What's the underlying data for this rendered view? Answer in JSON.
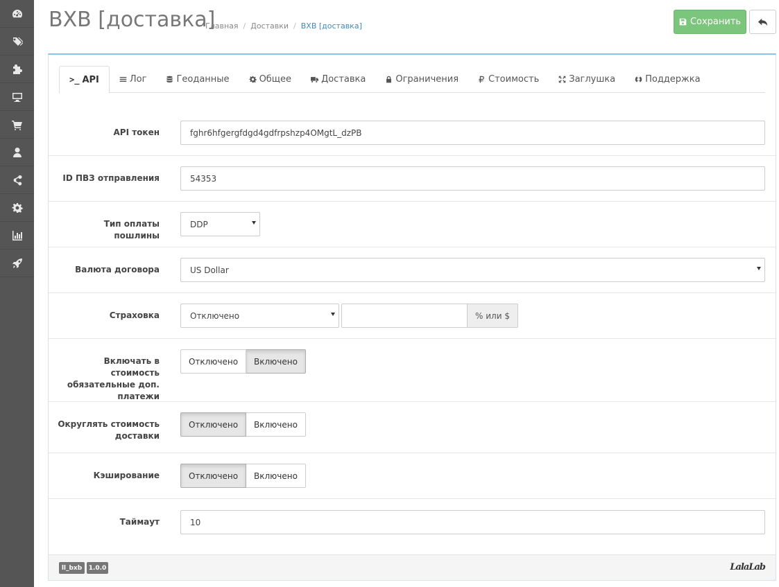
{
  "sidebar": {
    "items": [
      {
        "icon": "dashboard-icon"
      },
      {
        "icon": "tags-icon"
      },
      {
        "icon": "puzzle-icon"
      },
      {
        "icon": "desktop-icon"
      },
      {
        "icon": "cart-icon"
      },
      {
        "icon": "user-icon"
      },
      {
        "icon": "share-icon"
      },
      {
        "icon": "gear-icon"
      },
      {
        "icon": "bar-chart-icon"
      },
      {
        "icon": "rocket-icon"
      }
    ]
  },
  "header": {
    "title": "BXB [доставка]",
    "breadcrumb": [
      "Главная",
      "Доставки",
      "BXB [доставка]"
    ],
    "save_label": "Сохранить"
  },
  "tabs": [
    {
      "label": "API",
      "prefix": ">_",
      "icon": "terminal-icon",
      "active": true
    },
    {
      "label": "Лог",
      "icon": "list-icon"
    },
    {
      "label": "Геоданные",
      "icon": "database-icon"
    },
    {
      "label": "Общее",
      "icon": "gear-icon"
    },
    {
      "label": "Доставка",
      "icon": "truck-icon"
    },
    {
      "label": "Ограничения",
      "icon": "lock-icon"
    },
    {
      "label": "Стоимость",
      "icon": "ruble-icon"
    },
    {
      "label": "Заглушка",
      "icon": "expand-icon"
    },
    {
      "label": "Поддержка",
      "icon": "lifebuoy-icon"
    }
  ],
  "form": {
    "api_token": {
      "label": "API токен",
      "value": "fghr6hfgergfdgd4gdfrpshzp4OMgtL_dzPB"
    },
    "pvz_id": {
      "label": "ID ПВЗ отправления",
      "value": "54353"
    },
    "duty_type": {
      "label": "Тип оплаты пошлины",
      "value": "DDP"
    },
    "currency": {
      "label": "Валюта договора",
      "value": "US Dollar"
    },
    "insurance": {
      "label": "Страховка",
      "value": "Отключено",
      "amount": "",
      "addon": "% или $"
    },
    "include_payments": {
      "label": "Включать в стоимость обязательные доп. платежи",
      "off": "Отключено",
      "on": "Включено",
      "state": "on"
    },
    "round_cost": {
      "label": "Округлять стоимость доставки",
      "off": "Отключено",
      "on": "Включено",
      "state": "off"
    },
    "caching": {
      "label": "Кэширование",
      "off": "Отключено",
      "on": "Включено",
      "state": "off"
    },
    "timeout": {
      "label": "Таймаут",
      "value": "10"
    }
  },
  "footer": {
    "module_badge": "ll_bxb",
    "version_badge": "1.0.0",
    "logo_text": "LalaLab"
  },
  "colors": {
    "sidebar_bg": "#555555",
    "save_button": "#7cc57c",
    "panel_top_border": "#89c4e6",
    "breadcrumb_active": "#3c8dbc"
  }
}
